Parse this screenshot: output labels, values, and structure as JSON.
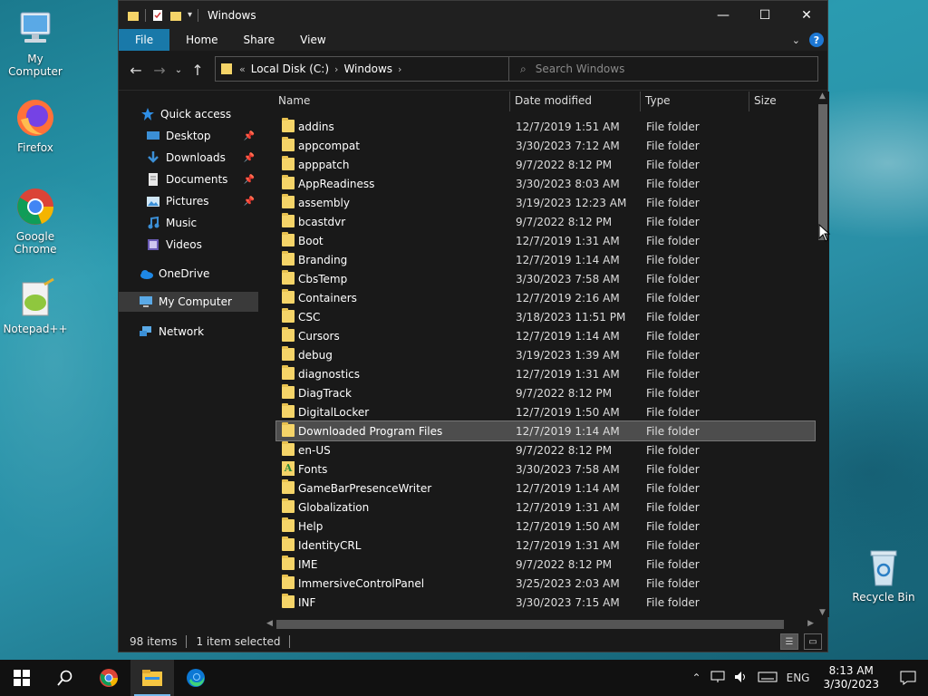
{
  "desktop": {
    "icons": [
      {
        "label": "My Computer"
      },
      {
        "label": "Firefox"
      },
      {
        "label": "Google Chrome"
      },
      {
        "label": "Notepad++"
      },
      {
        "label": "Recycle Bin"
      }
    ]
  },
  "window": {
    "title": "Windows",
    "ribbon_tabs": [
      "File",
      "Home",
      "Share",
      "View"
    ],
    "help_label": "?"
  },
  "address": {
    "overflow": "«",
    "crumbs": [
      "Local Disk (C:)",
      "Windows"
    ]
  },
  "search": {
    "placeholder": "Search Windows"
  },
  "navpane": {
    "items": [
      {
        "label": "Quick access"
      },
      {
        "label": "Desktop"
      },
      {
        "label": "Downloads"
      },
      {
        "label": "Documents"
      },
      {
        "label": "Pictures"
      },
      {
        "label": "Music"
      },
      {
        "label": "Videos"
      },
      {
        "label": "OneDrive"
      },
      {
        "label": "My Computer"
      },
      {
        "label": "Network"
      }
    ]
  },
  "columns": {
    "name": "Name",
    "date": "Date modified",
    "type": "Type",
    "size": "Size"
  },
  "files": [
    {
      "name": "addins",
      "date": "12/7/2019 1:51 AM",
      "type": "File folder"
    },
    {
      "name": "appcompat",
      "date": "3/30/2023 7:12 AM",
      "type": "File folder"
    },
    {
      "name": "apppatch",
      "date": "9/7/2022 8:12 PM",
      "type": "File folder"
    },
    {
      "name": "AppReadiness",
      "date": "3/30/2023 8:03 AM",
      "type": "File folder"
    },
    {
      "name": "assembly",
      "date": "3/19/2023 12:23 AM",
      "type": "File folder"
    },
    {
      "name": "bcastdvr",
      "date": "9/7/2022 8:12 PM",
      "type": "File folder"
    },
    {
      "name": "Boot",
      "date": "12/7/2019 1:31 AM",
      "type": "File folder"
    },
    {
      "name": "Branding",
      "date": "12/7/2019 1:14 AM",
      "type": "File folder"
    },
    {
      "name": "CbsTemp",
      "date": "3/30/2023 7:58 AM",
      "type": "File folder"
    },
    {
      "name": "Containers",
      "date": "12/7/2019 2:16 AM",
      "type": "File folder"
    },
    {
      "name": "CSC",
      "date": "3/18/2023 11:51 PM",
      "type": "File folder"
    },
    {
      "name": "Cursors",
      "date": "12/7/2019 1:14 AM",
      "type": "File folder"
    },
    {
      "name": "debug",
      "date": "3/19/2023 1:39 AM",
      "type": "File folder"
    },
    {
      "name": "diagnostics",
      "date": "12/7/2019 1:31 AM",
      "type": "File folder"
    },
    {
      "name": "DiagTrack",
      "date": "9/7/2022 8:12 PM",
      "type": "File folder"
    },
    {
      "name": "DigitalLocker",
      "date": "12/7/2019 1:50 AM",
      "type": "File folder"
    },
    {
      "name": "Downloaded Program Files",
      "date": "12/7/2019 1:14 AM",
      "type": "File folder"
    },
    {
      "name": "en-US",
      "date": "9/7/2022 8:12 PM",
      "type": "File folder"
    },
    {
      "name": "Fonts",
      "date": "3/30/2023 7:58 AM",
      "type": "File folder"
    },
    {
      "name": "GameBarPresenceWriter",
      "date": "12/7/2019 1:14 AM",
      "type": "File folder"
    },
    {
      "name": "Globalization",
      "date": "12/7/2019 1:31 AM",
      "type": "File folder"
    },
    {
      "name": "Help",
      "date": "12/7/2019 1:50 AM",
      "type": "File folder"
    },
    {
      "name": "IdentityCRL",
      "date": "12/7/2019 1:31 AM",
      "type": "File folder"
    },
    {
      "name": "IME",
      "date": "9/7/2022 8:12 PM",
      "type": "File folder"
    },
    {
      "name": "ImmersiveControlPanel",
      "date": "3/25/2023 2:03 AM",
      "type": "File folder"
    },
    {
      "name": "INF",
      "date": "3/30/2023 7:15 AM",
      "type": "File folder"
    }
  ],
  "status": {
    "items": "98 items",
    "selected": "1 item selected"
  },
  "taskbar": {
    "language": "ENG",
    "time": "8:13 AM",
    "date": "3/30/2023"
  },
  "colors": {
    "accent": "#1979a9",
    "folder": "#f5d468",
    "selection": "#4d4d4d"
  }
}
